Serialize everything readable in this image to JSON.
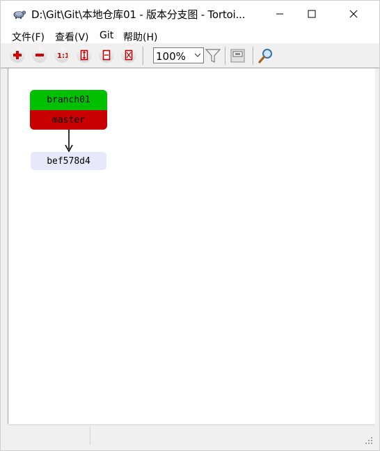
{
  "window": {
    "title": "D:\\Git\\Git\\本地仓库01 - 版本分支图 - Tortoi...",
    "app_icon": "tortoise-icon",
    "controls": [
      "minimize-icon",
      "maximize-icon",
      "close-icon"
    ]
  },
  "menu": {
    "file": "文件(F)",
    "view": "查看(V)",
    "git": "Git",
    "help": "帮助(H)"
  },
  "toolbar": {
    "buttons": [
      "zoom-in-icon",
      "zoom-out-icon",
      "zoom-100-icon",
      "zoom-height-icon",
      "zoom-width-icon",
      "zoom-fit-icon"
    ],
    "zoom_value": "100%",
    "filter_icon": "filter-icon",
    "overview_icon": "overview-icon",
    "search_icon": "search-icon"
  },
  "graph": {
    "branch_label": "branch01",
    "branch_color": "#00c000",
    "master_label": "master",
    "master_color": "#c80000",
    "commit_label": "bef578d4",
    "commit_color": "#e8e8fb"
  },
  "statusbar": {
    "pane1": "",
    "pane2": ""
  }
}
